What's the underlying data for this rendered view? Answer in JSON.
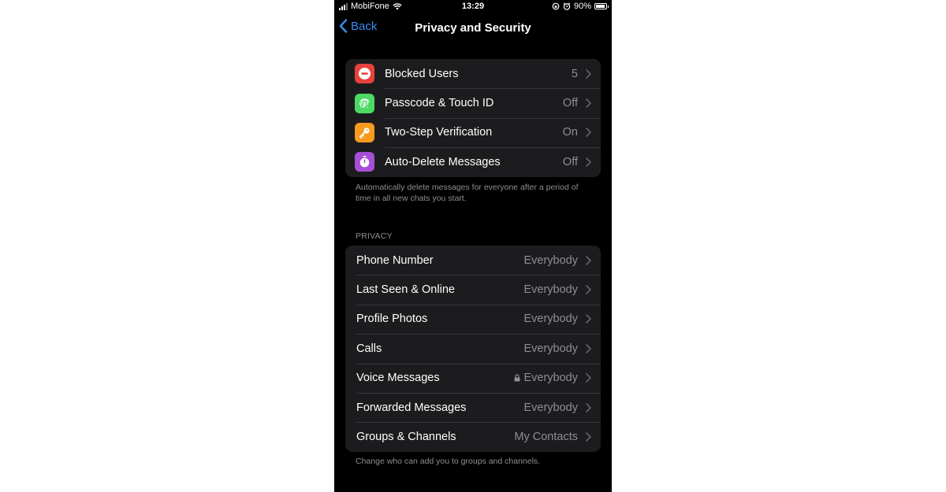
{
  "status_bar": {
    "carrier": "MobiFone",
    "time": "13:29",
    "battery_percent": "90%",
    "battery_level": 0.9
  },
  "nav": {
    "back_label": "Back",
    "title": "Privacy and Security"
  },
  "security": {
    "items": [
      {
        "label": "Blocked Users",
        "value": "5",
        "icon": "minus-circle-icon",
        "color": "#e9413b"
      },
      {
        "label": "Passcode & Touch ID",
        "value": "Off",
        "icon": "fingerprint-icon",
        "color": "#4cd964"
      },
      {
        "label": "Two-Step Verification",
        "value": "On",
        "icon": "key-icon",
        "color": "#f79a1d"
      },
      {
        "label": "Auto-Delete Messages",
        "value": "Off",
        "icon": "timer-icon",
        "color": "#a64fd6"
      }
    ],
    "footer": "Automatically delete messages for everyone after a period of time in all new chats you start."
  },
  "privacy": {
    "header": "PRIVACY",
    "items": [
      {
        "label": "Phone Number",
        "value": "Everybody"
      },
      {
        "label": "Last Seen & Online",
        "value": "Everybody"
      },
      {
        "label": "Profile Photos",
        "value": "Everybody"
      },
      {
        "label": "Calls",
        "value": "Everybody"
      },
      {
        "label": "Voice Messages",
        "value": "Everybody",
        "locked": true
      },
      {
        "label": "Forwarded Messages",
        "value": "Everybody"
      },
      {
        "label": "Groups & Channels",
        "value": "My Contacts"
      }
    ],
    "footer": "Change who can add you to groups and channels."
  },
  "colors": {
    "accent": "#3a8bf0",
    "background": "#000000",
    "cell": "#1c1c1e",
    "secondary_text": "#8e8e93"
  }
}
